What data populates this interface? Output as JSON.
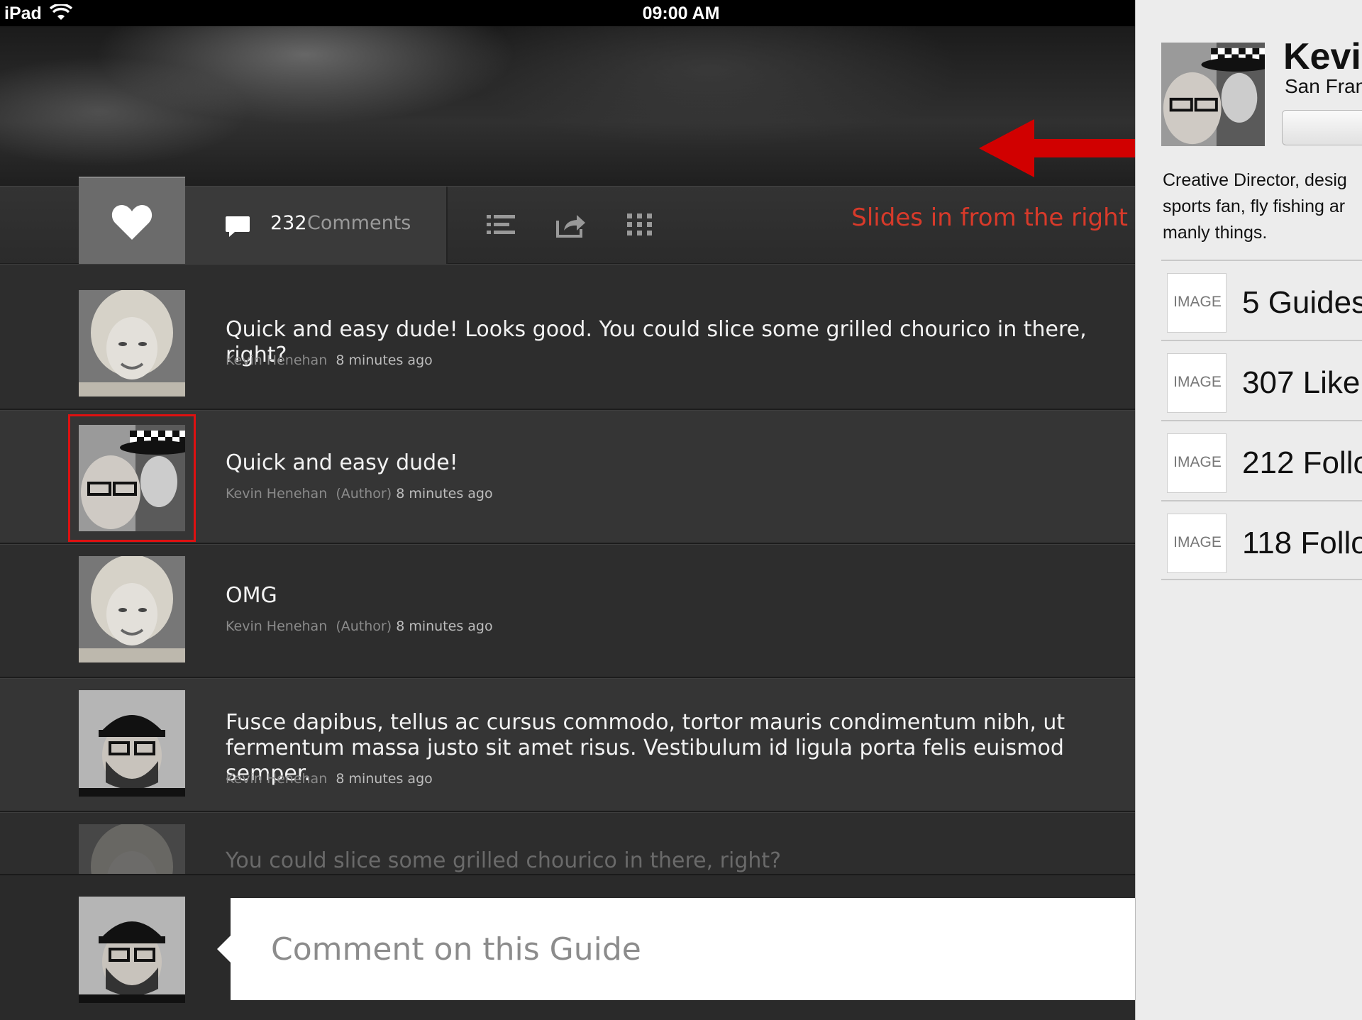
{
  "status_bar": {
    "device": "iPad",
    "time": "09:00 AM"
  },
  "toolbar": {
    "comment_count": "232",
    "comment_label": "Comments",
    "annotation": "Slides in from the right"
  },
  "comments": [
    {
      "text": "Quick and easy dude! Looks good. You could slice some grilled chourico in there, right?",
      "author": "Kevin Henehan",
      "author_tag": "",
      "time": "8 minutes ago",
      "avatar": "blonde-woman"
    },
    {
      "text": "Quick and easy dude!",
      "author": "Kevin Henehan",
      "author_tag": "(Author)",
      "time": "8 minutes ago",
      "avatar": "man-with-woman-in-police-hat"
    },
    {
      "text": "OMG",
      "author": "Kevin Henehan",
      "author_tag": "(Author)",
      "time": "8 minutes ago",
      "avatar": "blonde-woman"
    },
    {
      "text": "Fusce dapibus, tellus ac cursus commodo, tortor mauris condimentum nibh, ut fermentum massa justo sit amet risus. Vestibulum id ligula porta felis euismod semper.",
      "author": "Kevin Henehan",
      "author_tag": "",
      "time": "8 minutes ago",
      "avatar": "bearded-man-in-cap"
    },
    {
      "text": "You could slice some grilled chourico in there, right?",
      "author": "",
      "author_tag": "",
      "time": "",
      "avatar": "blonde-woman"
    }
  ],
  "compose": {
    "placeholder": "Comment on this Guide"
  },
  "profile": {
    "name": "Kevi",
    "location": "San Fran",
    "bio_lines": [
      "Creative Director, desig",
      "sports fan, fly fishing ar",
      "manly things."
    ],
    "stats": [
      {
        "thumb": "IMAGE",
        "label": "5 Guides"
      },
      {
        "thumb": "IMAGE",
        "label": "307 Like"
      },
      {
        "thumb": "IMAGE",
        "label": "212 Follo"
      },
      {
        "thumb": "IMAGE",
        "label": "118 Follo"
      }
    ]
  },
  "colors": {
    "annotation": "#d83a2a",
    "arrow": "#d10000",
    "panel_bg": "#ececec",
    "app_bg": "#2d2d2d"
  }
}
